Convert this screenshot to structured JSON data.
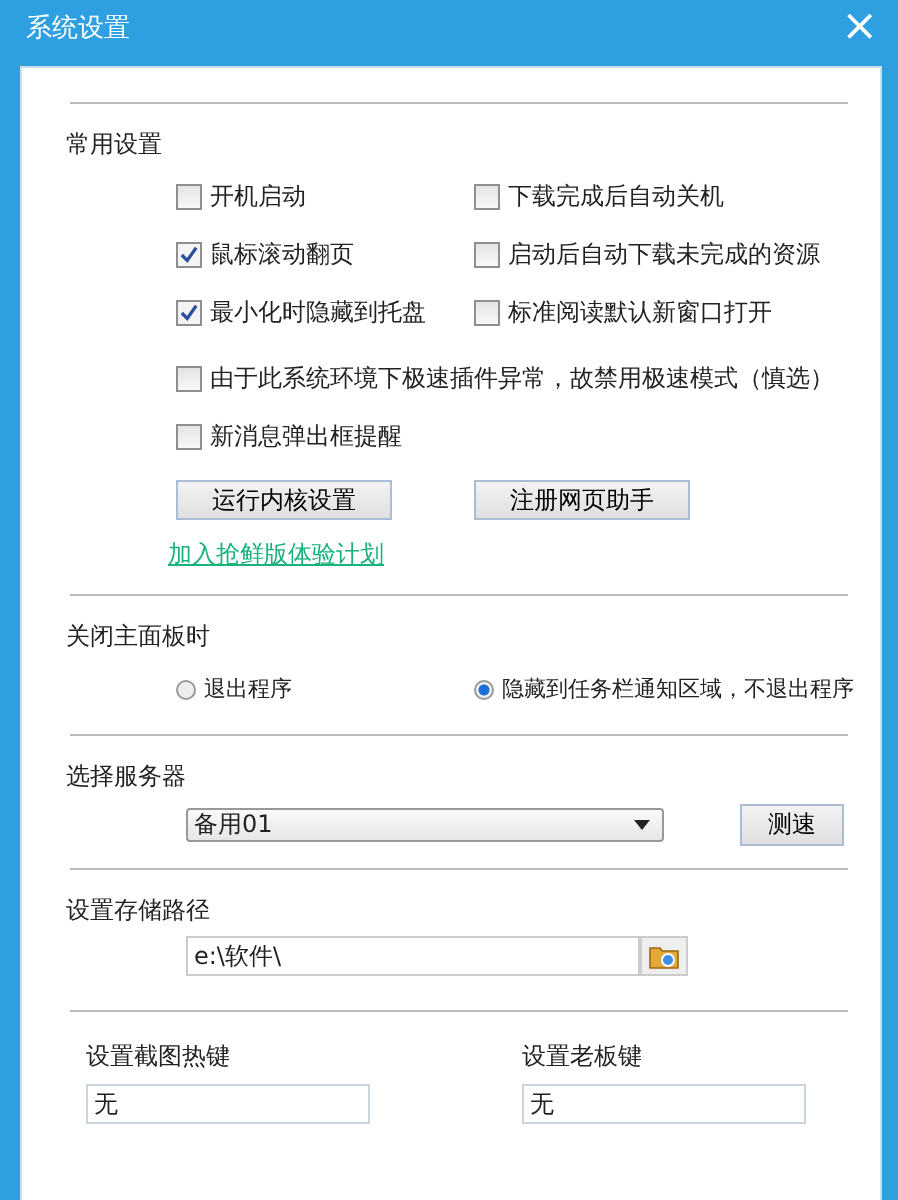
{
  "window": {
    "title": "系统设置",
    "close": "×"
  },
  "common": {
    "heading": "常用设置",
    "options": [
      {
        "label": "开机启动",
        "checked": false
      },
      {
        "label": "下载完成后自动关机",
        "checked": false
      },
      {
        "label": "鼠标滚动翻页",
        "checked": true
      },
      {
        "label": "启动后自动下载未完成的资源",
        "checked": false
      },
      {
        "label": "最小化时隐藏到托盘",
        "checked": true
      },
      {
        "label": "标准阅读默认新窗口打开",
        "checked": false
      }
    ],
    "wide_options": [
      {
        "label": "由于此系统环境下极速插件异常，故禁用极速模式（慎选）",
        "checked": false
      },
      {
        "label": "新消息弹出框提醒",
        "checked": false
      }
    ],
    "buttons": [
      "运行内核设置",
      "注册网页助手"
    ],
    "link": "加入抢鲜版体验计划"
  },
  "close_panel": {
    "heading": "关闭主面板时",
    "options": [
      {
        "label": "退出程序",
        "selected": false
      },
      {
        "label": "隐藏到任务栏通知区域，不退出程序",
        "selected": true
      }
    ]
  },
  "server": {
    "heading": "选择服务器",
    "value": "备用01",
    "button": "测速"
  },
  "storage": {
    "heading": "设置存储路径",
    "value": "e:\\软件\\"
  },
  "hotkeys": [
    {
      "label": "设置截图热键",
      "value": "无"
    },
    {
      "label": "设置老板键",
      "value": "无"
    }
  ]
}
